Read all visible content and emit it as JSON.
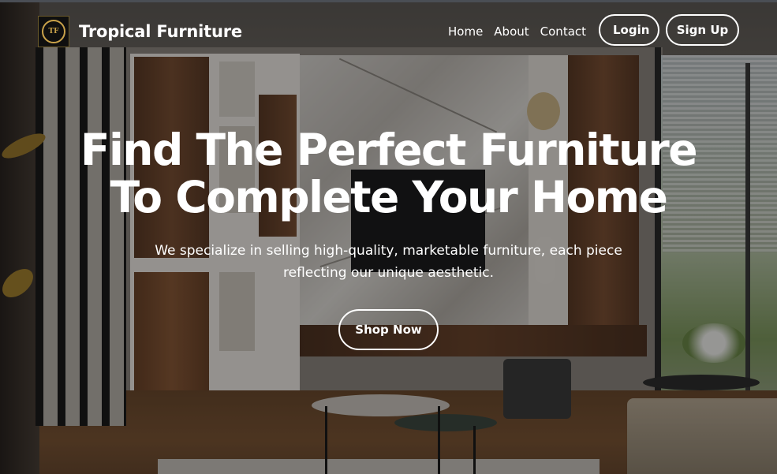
{
  "navbar": {
    "logo_text": "TF",
    "brand_name": "Tropical Furniture",
    "links": [
      "Home",
      "About",
      "Contact"
    ],
    "login_label": "Login",
    "signup_label": "Sign Up"
  },
  "hero": {
    "headline_line1": "Find The Perfect Furniture",
    "headline_line2": "To Complete Your Home",
    "subtitle": "We specialize in selling high-quality, marketable furniture, each piece reflecting our unique aesthetic.",
    "cta_label": "Shop Now"
  },
  "colors": {
    "text": "#ffffff",
    "overlay": "rgba(0,0,0,0.38)",
    "logo_gold": "#c9a24a"
  }
}
